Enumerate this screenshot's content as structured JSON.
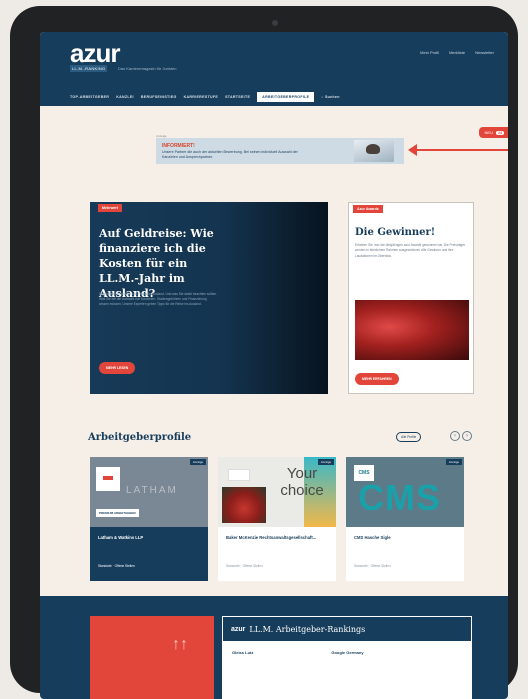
{
  "header": {
    "logo": "azur",
    "logo_sub": "LL.M.-RANKING",
    "tagline": "Das Karrieremagazin für Juristen",
    "utils": [
      "Mein Profil",
      "Merkliste",
      "Newsletter"
    ],
    "nav": [
      "TOP-ARBEITGEBER",
      "KANZLEI",
      "BERUFSEINSTIEG",
      "KARRIERESTUFE",
      "STARTSEITE"
    ],
    "nav_active": "ARBEITGEBERPROFILE",
    "search": "Suchen"
  },
  "ad": {
    "label": "Anzeige",
    "headline": "INFORMIERT!",
    "text": "Unsere Partner die auch der aktuellen Bewerbung. Bei seinen individuell Auswahl der Kanzleien und Ansprechpartner."
  },
  "pill": {
    "label": "NEU",
    "count": "24"
  },
  "hero": {
    "tag": "Mehrwert",
    "title": "Auf Geldreise: Wie finanziere ich die Kosten für ein LL.M.-Jahr im Ausland?",
    "body": "Stipendien für Studium und Praxis im Ausland. Und was Sie dabei beachten sollten. Was Sie bei der Auswahl von Kanzleien, Studiengebühren und Finanzierung wissen müssen. Unsere Experten geben Tipps für die Reise ins Ausland.",
    "button": "MEHR LESEN"
  },
  "side": {
    "tag": "Azur Awards",
    "title": "Die Gewinner!",
    "body": "Erfahren Sie, wer die diesjährigen azur Awards gewonnen hat. Die Preisträger wurden in feierlichem Rahmen ausgezeichnet. Alle Gewinner und ihre Laudationen im Überblick.",
    "button": "MEHR ERFAHREN"
  },
  "employers": {
    "title": "Arbeitgeberprofile",
    "all_button": "Alle Profile",
    "prev": "‹",
    "next": "›",
    "cards": [
      {
        "badge": "Anzeige",
        "image_text": "LATHAM",
        "image_label": "PREMIUM ARBEITGEBER",
        "name": "Latham & Watkins LLP",
        "meta": "Standorte · Offene Stellen"
      },
      {
        "badge": "Anzeige",
        "image_text": "Your choice",
        "name": "Baker McKenzie Rechtsanwaltsgesellschaft...",
        "meta": "Standorte · Offene Stellen"
      },
      {
        "badge": "Anzeige",
        "image_text": "CMS",
        "logo_text": "CMS",
        "name": "CMS Hasche Sigle",
        "meta": "Standorte · Offene Stellen"
      }
    ]
  },
  "ranking": {
    "logo": "azur",
    "title": "LL.M. Arbeitgeber-Rankings",
    "col1": "Gleiss Lutz",
    "col2": "Google Germany"
  },
  "colors": {
    "navy": "#173d5c",
    "accent": "#e2463a",
    "page": "#f5efe8"
  }
}
